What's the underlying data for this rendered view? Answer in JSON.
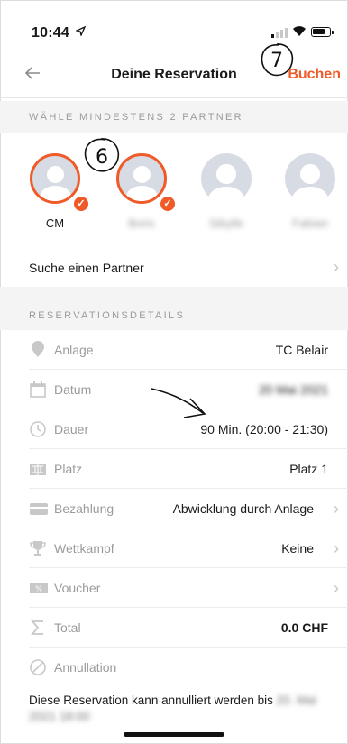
{
  "status": {
    "time": "10:44",
    "location_icon": "location-arrow-icon"
  },
  "nav": {
    "back_icon": "back-arrow-icon",
    "title": "Deine Reservation",
    "action": "Buchen"
  },
  "annotations": {
    "mark_7": "7",
    "mark_6": "6"
  },
  "partners": {
    "header": "WÄHLE MINDESTENS 2 PARTNER",
    "items": [
      {
        "name": "CM",
        "selected": true,
        "blurred": false
      },
      {
        "name": "Boris",
        "selected": true,
        "blurred": true
      },
      {
        "name": "Sibylle",
        "selected": false,
        "blurred": true
      },
      {
        "name": "Fabian",
        "selected": false,
        "blurred": true
      }
    ],
    "search_label": "Suche einen Partner"
  },
  "details": {
    "header": "RESERVATIONSDETAILS",
    "rows": [
      {
        "icon": "location-pin-icon",
        "label": "Anlage",
        "value": "TC Belair"
      },
      {
        "icon": "calendar-icon",
        "label": "Datum",
        "value": "20 Mai 2021"
      },
      {
        "icon": "clock-icon",
        "label": "Dauer",
        "value": "90 Min. (20:00 - 21:30)"
      },
      {
        "icon": "court-icon",
        "label": "Platz",
        "value": "Platz 1"
      },
      {
        "icon": "card-icon",
        "label": "Bezahlung",
        "value": "Abwicklung durch Anlage"
      },
      {
        "icon": "trophy-icon",
        "label": "Wettkampf",
        "value": "Keine"
      },
      {
        "icon": "voucher-icon",
        "label": "Voucher",
        "value": ""
      },
      {
        "icon": "sigma-icon",
        "label": "Total",
        "value": "0.0 CHF"
      },
      {
        "icon": "cancel-icon",
        "label": "Annullation",
        "value": ""
      }
    ],
    "cancel_note": "Diese Reservation kann annulliert werden bis",
    "cancel_note_blurred": "20. Mai 2021 18:00"
  },
  "colors": {
    "accent": "#f05a28",
    "muted": "#9b9b9b",
    "section_bg": "#f4f4f4"
  }
}
